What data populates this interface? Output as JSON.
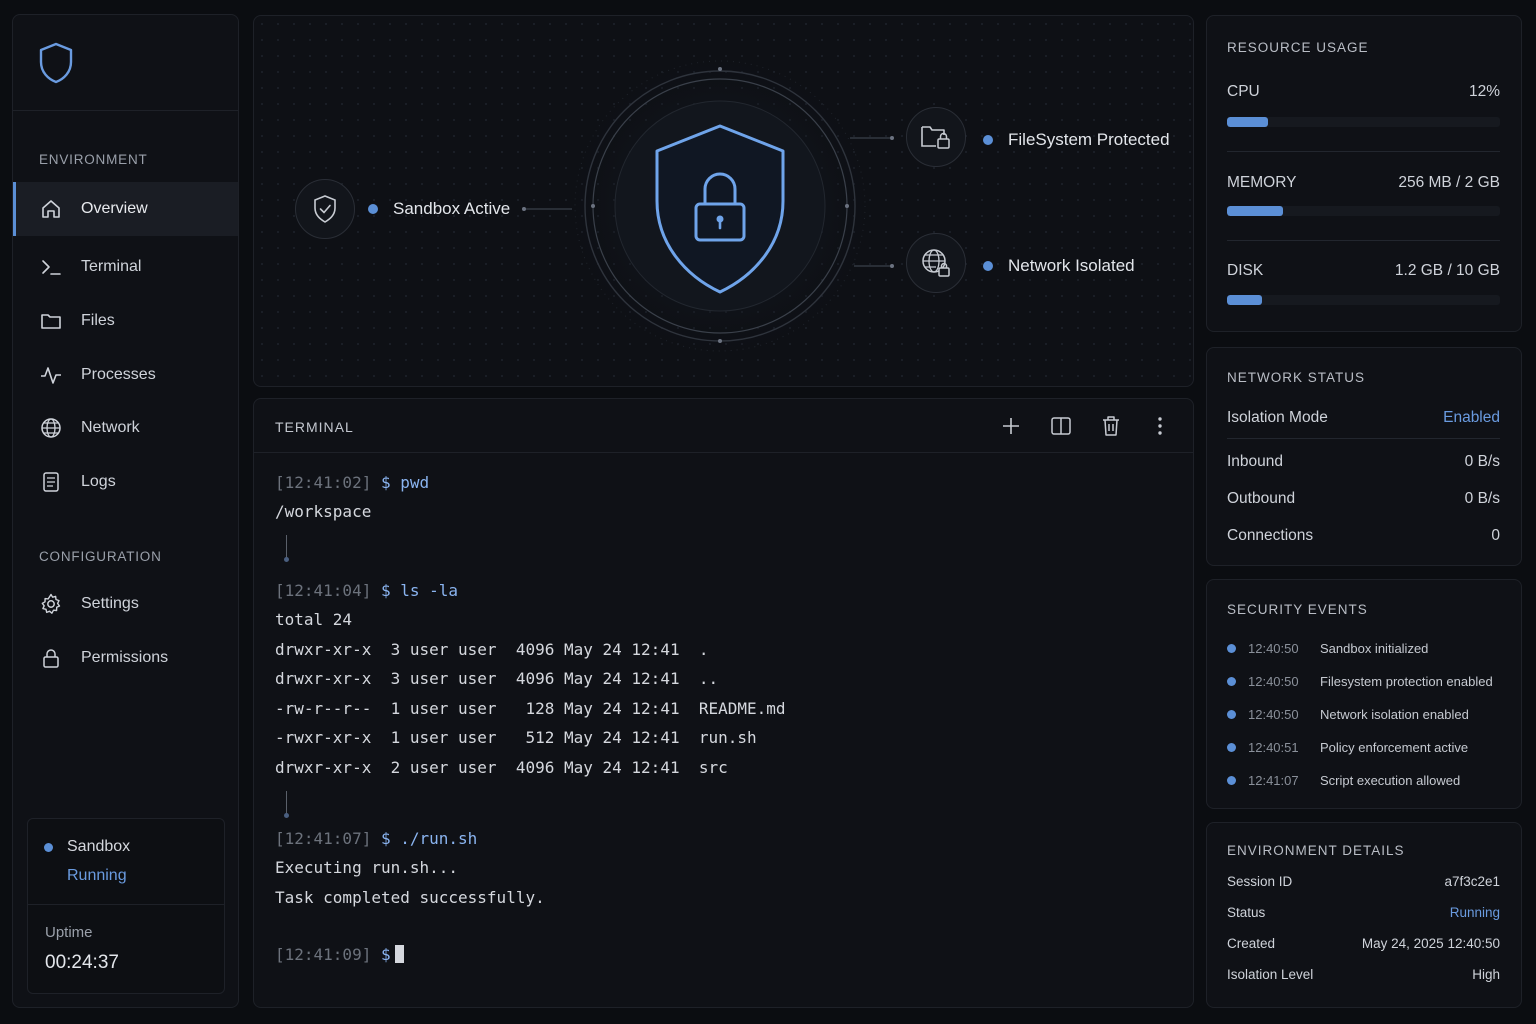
{
  "colors": {
    "accent": "#5b8fd6",
    "background": "#0b0d11",
    "panel": "#0f1116"
  },
  "sidebar": {
    "logo_icon": "shield-icon",
    "environment_title": "ENVIRONMENT",
    "environment_items": [
      {
        "label": "Overview",
        "icon": "home-icon",
        "active": true
      },
      {
        "label": "Terminal",
        "icon": "terminal-icon"
      },
      {
        "label": "Files",
        "icon": "folder-icon"
      },
      {
        "label": "Processes",
        "icon": "activity-icon"
      },
      {
        "label": "Network",
        "icon": "globe-icon"
      },
      {
        "label": "Logs",
        "icon": "document-icon"
      }
    ],
    "configuration_title": "CONFIGURATION",
    "configuration_items": [
      {
        "label": "Settings",
        "icon": "gear-icon"
      },
      {
        "label": "Permissions",
        "icon": "lock-icon"
      }
    ],
    "status": {
      "name": "Sandbox",
      "state": "Running",
      "uptime_label": "Uptime",
      "uptime": "00:24:37"
    }
  },
  "hero": {
    "sandbox_label": "Sandbox Active",
    "filesystem_label": "FileSystem Protected",
    "network_label": "Network Isolated"
  },
  "terminal": {
    "title": "TERMINAL",
    "blocks": [
      {
        "ts": "[12:41:02]",
        "prompt": "$",
        "cmd": "pwd",
        "output": [
          "/workspace"
        ]
      },
      {
        "ts": "[12:41:04]",
        "prompt": "$",
        "cmd": "ls -la",
        "output": [
          "total 24",
          "drwxr-xr-x  3 user user  4096 May 24 12:41  .",
          "drwxr-xr-x  3 user user  4096 May 24 12:41  ..",
          "-rw-r--r--  1 user user   128 May 24 12:41  README.md",
          "-rwxr-xr-x  1 user user   512 May 24 12:41  run.sh",
          "drwxr-xr-x  2 user user  4096 May 24 12:41  src"
        ]
      },
      {
        "ts": "[12:41:07]",
        "prompt": "$",
        "cmd": "./run.sh",
        "output": [
          "Executing run.sh...",
          "Task completed successfully."
        ]
      },
      {
        "ts": "[12:41:09]",
        "prompt": "$",
        "cmd": "",
        "output": []
      }
    ]
  },
  "resources": {
    "title": "RESOURCE USAGE",
    "cpu": {
      "label": "CPU",
      "value": "12%",
      "fraction": 0.15
    },
    "memory": {
      "label": "MEMORY",
      "value": "256 MB / 2 GB",
      "fraction": 0.205
    },
    "disk": {
      "label": "DISK",
      "value": "1.2 GB / 10 GB",
      "fraction": 0.13
    }
  },
  "network": {
    "title": "NETWORK STATUS",
    "isolation_label": "Isolation Mode",
    "isolation_value": "Enabled",
    "inbound_label": "Inbound",
    "inbound_value": "0 B/s",
    "outbound_label": "Outbound",
    "outbound_value": "0 B/s",
    "connections_label": "Connections",
    "connections_value": "0"
  },
  "events": {
    "title": "SECURITY EVENTS",
    "items": [
      {
        "time": "12:40:50",
        "message": "Sandbox initialized"
      },
      {
        "time": "12:40:50",
        "message": "Filesystem protection enabled"
      },
      {
        "time": "12:40:50",
        "message": "Network isolation enabled"
      },
      {
        "time": "12:40:51",
        "message": "Policy enforcement active"
      },
      {
        "time": "12:41:07",
        "message": "Script execution allowed"
      }
    ]
  },
  "environment": {
    "title": "ENVIRONMENT DETAILS",
    "session_label": "Session ID",
    "session_value": "a7f3c2e1",
    "status_label": "Status",
    "status_value": "Running",
    "created_label": "Created",
    "created_value": "May 24, 2025 12:40:50",
    "level_label": "Isolation Level",
    "level_value": "High"
  }
}
